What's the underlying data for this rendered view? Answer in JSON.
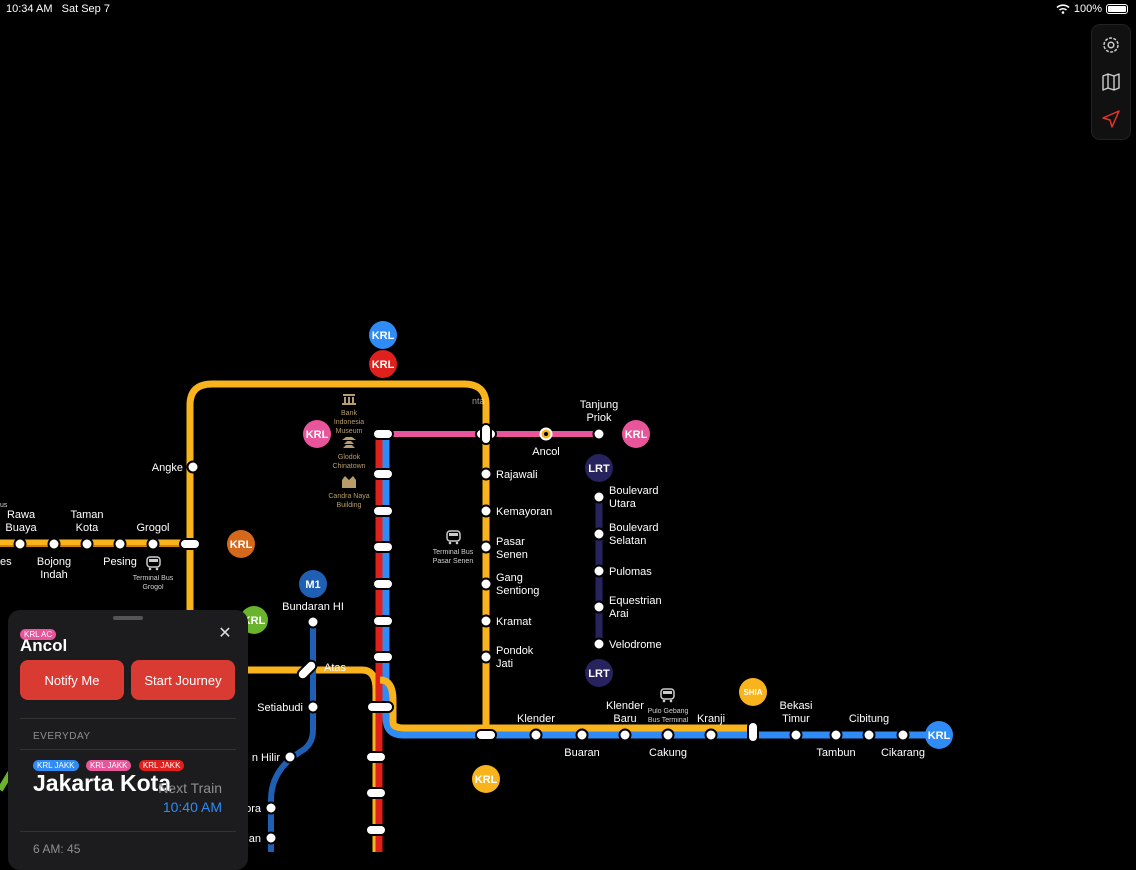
{
  "status_bar": {
    "time": "10:34 AM",
    "date": "Sat Sep 7",
    "battery": "100%"
  },
  "colors": {
    "yellow": "#f9b31d",
    "red": "#e0201c",
    "blue": "#2f8cf6",
    "pink": "#e8559a",
    "navy": "#26235e",
    "steel": "#1f5fb4",
    "orange_krl": "#d4691c",
    "green_krl": "#6ab42d",
    "button_red": "#d93a32"
  },
  "toolbar": {
    "icons": [
      "settings-icon",
      "map-icon",
      "location-arrow-icon"
    ]
  },
  "badges": {
    "krl": "KRL",
    "lrt": "LRT",
    "m1": "M1",
    "shia": "SHIA"
  },
  "stations": {
    "angke": "Angke",
    "rawa_buaya_1": "Rawa",
    "rawa_buaya_2": "Buaya",
    "taman_kota_1": "Taman",
    "taman_kota_2": "Kota",
    "grogol": "Grogol",
    "bojong_1": "Bojong",
    "bojong_2": "Indah",
    "pesing": "Pesing",
    "es": "es",
    "bus_trunc": "us",
    "tanjung_1": "Tanjung",
    "tanjung_2": "Priok",
    "ancol": "Ancol",
    "rajawali": "Rajawali",
    "kemayoran": "Kemayoran",
    "pasar_senen_1": "Pasar",
    "pasar_senen_2": "Senen",
    "gang_1": "Gang",
    "gang_2": "Sentiong",
    "kramat": "Kramat",
    "pondok_1": "Pondok",
    "pondok_2": "Jati",
    "blv_utara_1": "Boulevard",
    "blv_utara_2": "Utara",
    "blv_selatan_1": "Boulevard",
    "blv_selatan_2": "Selatan",
    "pulomas": "Pulomas",
    "equestrian_1": "Equestrian",
    "equestrian_2": "Arai",
    "velodrome": "Velodrome",
    "bundaran": "Bundaran HI",
    "atas": "Atas",
    "setiabudi": "Setiabudi",
    "n_hilir": "n Hilir",
    "ora": "ora",
    "an": "an",
    "klender": "Klender",
    "klender_baru_1": "Klender",
    "klender_baru_2": "Baru",
    "kranji": "Kranji",
    "bekasi_timur_1": "Bekasi",
    "bekasi_timur_2": "Timur",
    "cibitung": "Cibitung",
    "buaran": "Buaran",
    "cakung": "Cakung",
    "tambun": "Tambun",
    "cikarang": "Cikarang",
    "jakarta_kota_partial": "nta"
  },
  "pois": {
    "bank_1": "Bank",
    "bank_2": "Indonesia",
    "bank_3": "Museum",
    "glodok_1": "Glodok",
    "glodok_2": "Chinatown",
    "candra_1": "Candra Naya",
    "candra_2": "Building",
    "tb_senen_1": "Terminal Bus",
    "tb_senen_2": "Pasar Senen",
    "tb_grogol_1": "Terminal Bus",
    "tb_grogol_2": "Grogol",
    "pulo_1": "Pulo Gebang",
    "pulo_2": "Bus Terminal"
  },
  "panel": {
    "line_pill": "KRL AC",
    "station_name": "Ancol",
    "notify_button": "Notify Me",
    "start_button": "Start Journey",
    "cadence": "EVERYDAY",
    "route_pills": [
      "KRL JAKK",
      "KRL JAKK",
      "KRL JAKK"
    ],
    "destination": "Jakarta Kota",
    "next_train_label": "Next Train",
    "next_train_time": "10:40 AM",
    "frequency": "6 AM: 45"
  }
}
